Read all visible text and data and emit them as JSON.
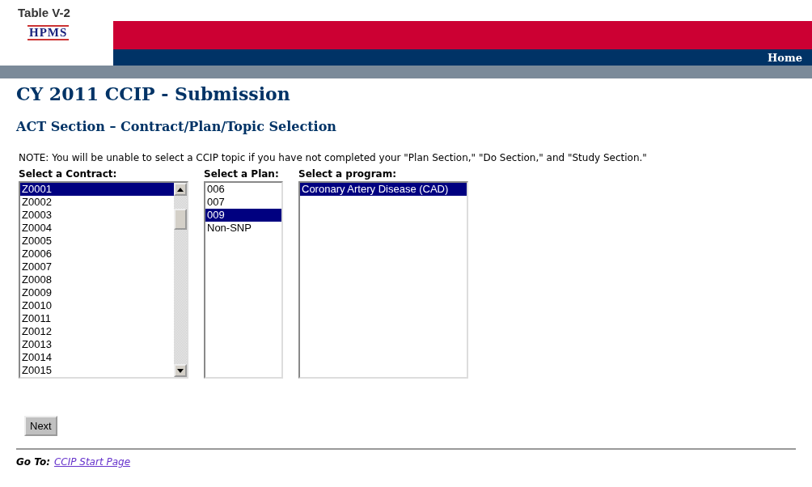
{
  "caption": "Table V-2",
  "logo": "HPMS",
  "nav": {
    "home": "Home"
  },
  "title": "CY 2011 CCIP - Submission",
  "subtitle": "ACT Section – Contract/Plan/Topic Selection",
  "note": "NOTE: You will be unable to select a CCIP topic if you have not completed your \"Plan Section,\" \"Do Section,\" and \"Study Section.\"",
  "lists": [
    {
      "label": "Select a Contract:",
      "kind": "contract",
      "items": [
        {
          "text": "Z0001",
          "selected": true
        },
        {
          "text": "Z0002",
          "selected": false
        },
        {
          "text": "Z0003",
          "selected": false
        },
        {
          "text": "Z0004",
          "selected": false
        },
        {
          "text": "Z0005",
          "selected": false
        },
        {
          "text": "Z0006",
          "selected": false
        },
        {
          "text": "Z0007",
          "selected": false
        },
        {
          "text": "Z0008",
          "selected": false
        },
        {
          "text": "Z0009",
          "selected": false
        },
        {
          "text": "Z0010",
          "selected": false
        },
        {
          "text": "Z0011",
          "selected": false
        },
        {
          "text": "Z0012",
          "selected": false
        },
        {
          "text": "Z0013",
          "selected": false
        },
        {
          "text": "Z0014",
          "selected": false
        },
        {
          "text": "Z0015",
          "selected": false
        }
      ]
    },
    {
      "label": "Select a Plan:",
      "kind": "plan",
      "items": [
        {
          "text": "006",
          "selected": false
        },
        {
          "text": "007",
          "selected": false
        },
        {
          "text": "009",
          "selected": true
        },
        {
          "text": "Non-SNP",
          "selected": false
        }
      ]
    },
    {
      "label": "Select a program:",
      "kind": "program",
      "items": [
        {
          "text": "Coronary Artery Disease (CAD)",
          "selected": true
        }
      ]
    }
  ],
  "next_button": "Next",
  "goto": {
    "label": "Go To:",
    "link": "CCIP Start Page"
  }
}
